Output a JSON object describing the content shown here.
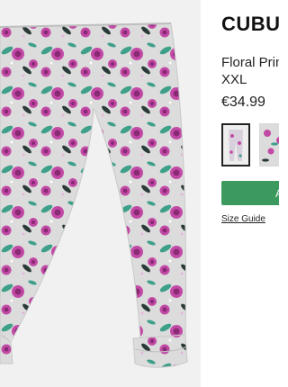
{
  "product": {
    "brand": "CUBUS",
    "title": "Floral Prin",
    "size": "XXL",
    "price": "€34.99"
  },
  "gallery": {
    "image_alt": "floral-print-leggings",
    "pattern_colors": {
      "base": "#dcdcdc",
      "rose": "#c24aa6",
      "rose_dark": "#8a2a74",
      "leaf": "#3fa08a",
      "leaf_dark": "#2a3a38"
    }
  },
  "actions": {
    "add_button_label": "A",
    "add_button_color": "#3d9a5f",
    "size_guide_label": "Size Guide"
  }
}
